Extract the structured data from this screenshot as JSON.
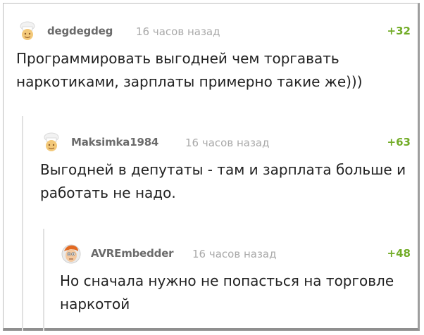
{
  "comments": [
    {
      "author": "degdegdeg",
      "time": "16 часов назад",
      "score": "+32",
      "text": "Программировать выгодней чем торгавать наркотиками, зарплаты примерно такие же)))",
      "avatar_icon": "chef-avatar-icon"
    },
    {
      "author": "Maksimka1984",
      "time": "16 часов назад",
      "score": "+63",
      "text": "Выгодней в депутаты - там и зарплата больше и работать не надо.",
      "avatar_icon": "chef-avatar-icon"
    },
    {
      "author": "AVREmbedder",
      "time": "16 часов назад",
      "score": "+48",
      "text": "Но сначала нужно не попасться на торговле наркотой",
      "avatar_icon": "fry-avatar-icon"
    }
  ],
  "colors": {
    "score": "#72ac27",
    "author": "#6b6b6b",
    "time": "#a9a9a9",
    "text": "#222222"
  }
}
